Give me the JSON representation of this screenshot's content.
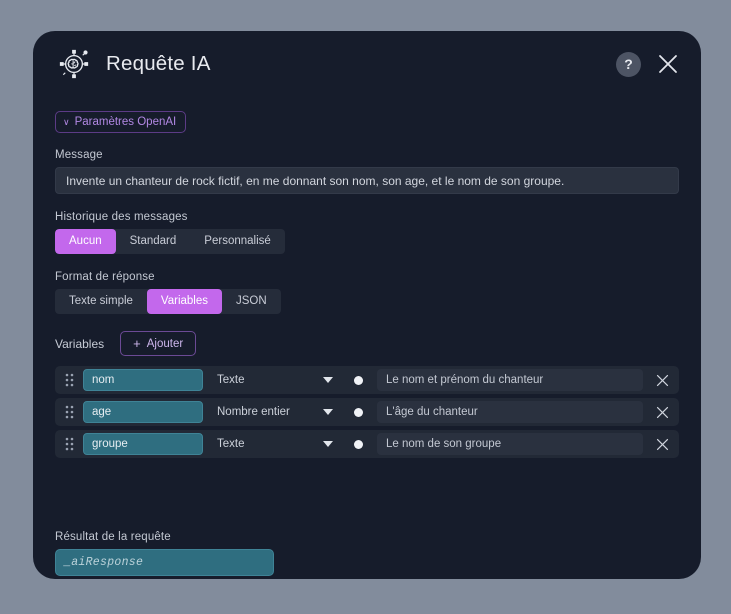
{
  "window": {
    "title": "Requête IA",
    "brand_icon": "ai-brain-icon",
    "help_label": "?",
    "close_label": "×"
  },
  "settings_toggle": {
    "chevron": "∨",
    "label": "Paramètres OpenAI"
  },
  "message": {
    "label": "Message",
    "value": "Invente un chanteur de rock fictif, en me donnant son nom, son age, et le nom de son groupe."
  },
  "history": {
    "label": "Historique des messages",
    "options": [
      "Aucun",
      "Standard",
      "Personnalisé"
    ],
    "selected": "Aucun"
  },
  "response_format": {
    "label": "Format de réponse",
    "options": [
      "Texte simple",
      "Variables",
      "JSON"
    ],
    "selected": "Variables"
  },
  "variables": {
    "label": "Variables",
    "add_label": "Ajouter",
    "add_icon": "plus-icon",
    "rows": [
      {
        "drag_icon": "drag-handle-icon",
        "name": "nom",
        "type": "Texte",
        "dot": "required-dot",
        "description": "Le nom et prénom du chanteur",
        "delete_icon": "close-icon"
      },
      {
        "drag_icon": "drag-handle-icon",
        "name": "age",
        "type": "Nombre entier",
        "dot": "required-dot",
        "description": "L'âge du chanteur",
        "delete_icon": "close-icon"
      },
      {
        "drag_icon": "drag-handle-icon",
        "name": "groupe",
        "type": "Texte",
        "dot": "required-dot",
        "description": "Le nom de son groupe",
        "delete_icon": "close-icon"
      }
    ]
  },
  "result": {
    "label": "Résultat de la requête",
    "value": "_aiResponse"
  },
  "side_tab": {
    "icon": "gear-icon"
  },
  "colors": {
    "background": "#828c9c",
    "panel": "#161c2b",
    "accent_purple": "#c368ec",
    "accent_purple_border": "#6b4a95",
    "teal_field": "#2f6e80",
    "row_bg": "#222936"
  }
}
